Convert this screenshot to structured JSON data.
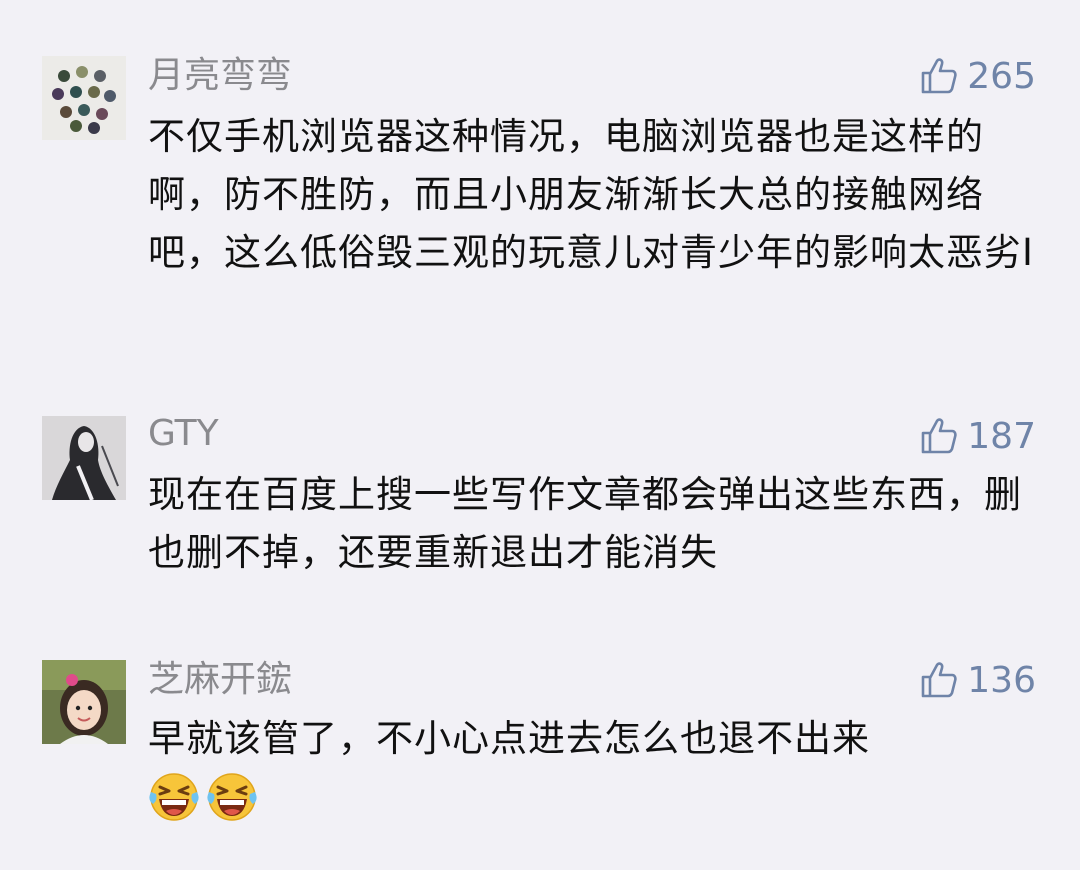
{
  "comments": [
    {
      "username": "月亮弯弯",
      "likes": "265",
      "text": "不仅手机浏览器这种情况，电脑浏览器也是这样的啊，防不胜防，而且小朋友渐渐长大总的接触网络吧，这么低俗毁三观的玩意儿对青少年的影响太恶劣I",
      "avatar_icon": "pearls-avatar"
    },
    {
      "username": "GTY",
      "likes": "187",
      "text": "现在在百度上搜一些写作文章都会弹出这些东西，删也删不掉，还要重新退出才能消失",
      "avatar_icon": "sketch-figure-avatar"
    },
    {
      "username": "芝麻开鋐",
      "likes": "136",
      "text": "早就该管了，不小心点进去怎么也退不出来",
      "avatar_icon": "child-photo-avatar",
      "emojis": [
        "laughing-crying-emoji",
        "laughing-crying-emoji"
      ]
    }
  ],
  "colors": {
    "background": "#f2f1f6",
    "username": "#8a8a8e",
    "like": "#6f84a8",
    "text": "#111111"
  }
}
